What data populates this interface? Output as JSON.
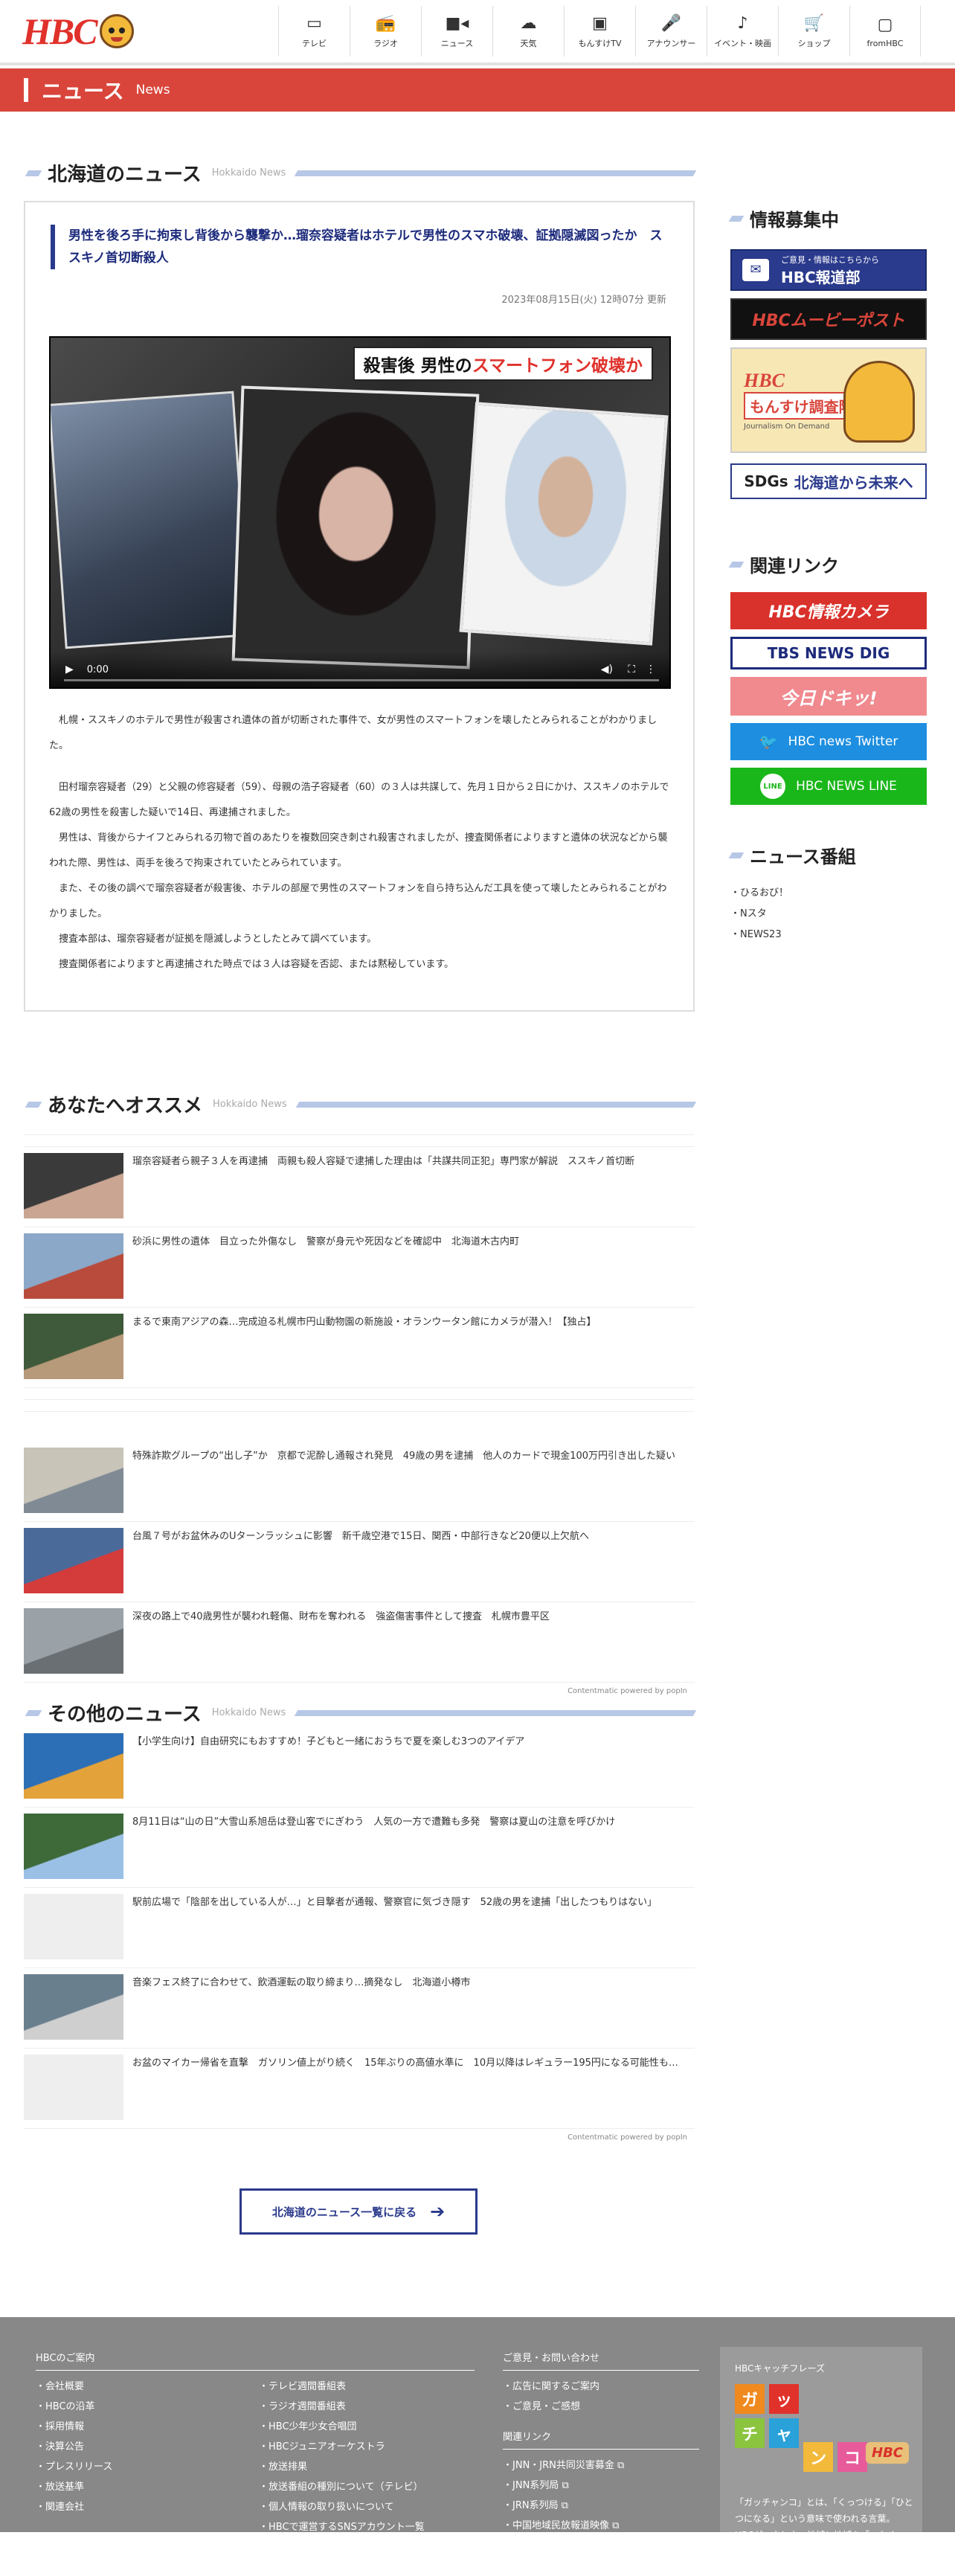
{
  "header": {
    "logo_text": "HBC",
    "nav": [
      {
        "label": "テレビ",
        "icon": "tv-icon",
        "glyph": "▭"
      },
      {
        "label": "ラジオ",
        "icon": "radio-icon",
        "glyph": "📻"
      },
      {
        "label": "ニュース",
        "icon": "news-camera-icon",
        "glyph": "■◂"
      },
      {
        "label": "天気",
        "icon": "weather-icon",
        "glyph": "☁"
      },
      {
        "label": "もんすけTV",
        "icon": "video-icon",
        "glyph": "▣"
      },
      {
        "label": "アナウンサー",
        "icon": "microphone-icon",
        "glyph": "🎤"
      },
      {
        "label": "イベント・映画",
        "icon": "music-note-icon",
        "glyph": "♪"
      },
      {
        "label": "ショップ",
        "icon": "cart-icon",
        "glyph": "🛒"
      },
      {
        "label": "fromHBC",
        "icon": "bag-icon",
        "glyph": "▢"
      }
    ]
  },
  "news_bar": {
    "title": "ニュース",
    "subtitle": "News"
  },
  "hokkaido": {
    "title": "北海道のニュース",
    "subtitle": "Hokkaido News"
  },
  "article": {
    "headline": "男性を後ろ手に拘束し背後から襲撃か…瑠奈容疑者はホテルで男性のスマホ破壊、証拠隠滅図ったか　ススキノ首切断殺人",
    "date": "2023年08月15日(火) 12時07分 更新",
    "video_caption_a": "殺害後 男性の",
    "video_caption_b": "スマートフォン破壊か",
    "video_time": "0:00",
    "paragraphs": [
      "札幌・ススキノのホテルで男性が殺害され遺体の首が切断された事件で、女が男性のスマートフォンを壊したとみられることがわかりました。",
      "",
      "田村瑠奈容疑者（29）と父親の修容疑者（59）、母親の浩子容疑者（60）の３人は共謀して、先月１日から２日にかけ、ススキノのホテルで62歳の男性を殺害した疑いで14日、再逮捕されました。",
      "男性は、背後からナイフとみられる刃物で首のあたりを複数回突き刺され殺害されましたが、捜査関係者によりますと遺体の状況などから襲われた際、男性は、両手を後ろで拘束されていたとみられています。",
      "また、その後の調べで瑠奈容疑者が殺害後、ホテルの部屋で男性のスマートフォンを自ら持ち込んだ工具を使って壊したとみられることがわかりました。",
      "捜査本部は、瑠奈容疑者が証拠を隠滅しようとしたとみて調べています。",
      "捜査関係者によりますと再逮捕された時点では３人は容疑を否認、または黙秘しています。"
    ]
  },
  "recommend": {
    "title": "あなたへオススメ",
    "subtitle": "Hokkaido News",
    "group1": [
      "瑠奈容疑者ら親子３人を再逮捕　両親も殺人容疑で逮捕した理由は「共謀共同正犯」専門家が解説　ススキノ首切断",
      "砂浜に男性の遺体　目立った外傷なし　警察が身元や死因などを確認中　北海道木古内町",
      "まるで東南アジアの森…完成迫る札幌市円山動物園の新施設・オランウータン館にカメラが潜入！【独占】"
    ],
    "group2": [
      "特殊詐欺グループの“出し子”か　京都で泥酔し通報され発見　49歳の男を逮捕　他人のカードで現金100万円引き出した疑い",
      "台風７号がお盆休みのUターンラッシュに影響　新千歳空港で15日、関西・中部行きなど20便以上欠航へ",
      "深夜の路上で40歳男性が襲われ軽傷、財布を奪われる　強盗傷害事件として捜査　札幌市豊平区"
    ],
    "powered": "Contentmatic powered by  popIn"
  },
  "other": {
    "title": "その他のニュース",
    "subtitle": "Hokkaido News",
    "items": [
      "【小学生向け】自由研究にもおすすめ！子どもと一緒におうちで夏を楽しむ3つのアイデア",
      "8月11日は“山の日”大雪山系旭岳は登山客でにぎわう　人気の一方で遭難も多発　警察は夏山の注意を呼びかけ",
      "駅前広場で「陰部を出している人が…」と目撃者が通報、警察官に気づき隠す　52歳の男を逮捕「出したつもりはない」",
      "音楽フェス終了に合わせて、飲酒運転の取り締まり…摘発なし　北海道小樽市",
      "お盆のマイカー帰省を直撃　ガソリン値上がり続く　15年ぶりの高値水準に　10月以降はレギュラー195円になる可能性も…"
    ],
    "powered": "Contentmatic powered by  popIn"
  },
  "back_button": "北海道のニュース一覧に戻る",
  "sidebar": {
    "recruit_title": "情報募集中",
    "banner_report_small": "ご意見・情報はこちらから",
    "banner_report": "HBC報道部",
    "banner_movie": "HBCムービーポスト",
    "banner_monsuke_brand": "HBC",
    "banner_monsuke": "もんすけ調査隊",
    "banner_monsuke_sub": "Journalism On Demand",
    "banner_sdgs_a": "SDGs",
    "banner_sdgs_b": "北海道から未来へ",
    "links_title": "関連リンク",
    "link_camera": "HBC情報カメラ",
    "link_tbs": "TBS NEWS DIG",
    "link_kyou": "今日ドキッ!",
    "link_twitter": "HBC news Twitter",
    "link_line": "HBC NEWS LINE",
    "programs_title": "ニュース番組",
    "programs": [
      "ひるおび！",
      "Nスタ",
      "NEWS23"
    ]
  },
  "footer": {
    "about_title": "HBCのご案内",
    "about_col1": [
      "会社概要",
      "HBCの沿革",
      "採用情報",
      "決算公告",
      "プレスリリース",
      "放送基準",
      "関連会社"
    ],
    "about_col2": [
      "テレビ週間番組表",
      "ラジオ週間番組表",
      "HBC少年少女合唱団",
      "HBCジュニアオーケストラ",
      "放送排果",
      "放送番組の種別について（テレビ）",
      "個人情報の取り扱いについて",
      "HBCで運営するSNSアカウント一覧"
    ],
    "contact_title": "ご意見・お問い合わせ",
    "contact": [
      "広告に関するご案内",
      "ご意見・ご感想"
    ],
    "related_title": "関連リンク",
    "related": [
      "JNN・JRN共同災害募金",
      "JNN系列局",
      "JRN系列局",
      "中国地域民放報道映像"
    ],
    "catch_title": "HBCキャッチフレーズ",
    "catch_tiles": [
      "ガ",
      "ッ",
      "チ",
      "ャ",
      "ン",
      "コ"
    ],
    "catch_logo": "HBC",
    "catch_text": "「ガッチャンコ」とは、「くっつける」「ひとつになる」という意味で使われる言葉。HBCが、人と人、地域と地域を「つなぐ」存在でありたいという願いがこめられています。"
  },
  "colors": {
    "brand_red": "#d9453b",
    "navy": "#2a3a8c",
    "accent_blue": "#b7c7e6"
  }
}
